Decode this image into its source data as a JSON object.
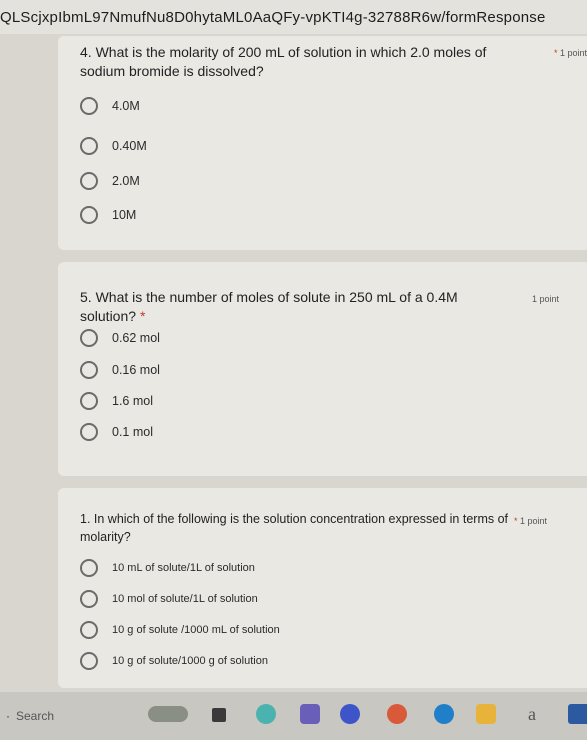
{
  "browser": {
    "url": "QLScjxpIbmL97NmufNu8D0hytaML0AaQFy-vpKTI4g-32788R6w/formResponse"
  },
  "questions": [
    {
      "title": "4. What is the molarity of 200 mL of solution in which 2.0 moles of sodium bromide is dissolved?",
      "required_mark": "*",
      "points": "1 point",
      "options": [
        "4.0M",
        "0.40M",
        "2.0M",
        "10M"
      ]
    },
    {
      "title": "5. What is the number of moles of solute in 250 mL of a 0.4M solution?",
      "required_mark": "*",
      "points": "1 point",
      "options": [
        "0.62 mol",
        "0.16 mol",
        "1.6 mol",
        "0.1 mol"
      ]
    },
    {
      "title": "1. In which of the following is the solution concentration expressed in terms of molarity?",
      "required_mark": "*",
      "points": "1 point",
      "options": [
        "10 mL of solute/1L of solution",
        "10 mol of solute/1L of solution",
        "10 g of solute /1000 mL of solution",
        "10 g of solute/1000 g of solution"
      ]
    }
  ],
  "taskbar": {
    "search_placeholder": "Search",
    "font_icon_glyph": "a",
    "icons": [
      "weather-icon",
      "task-view-icon",
      "widgets-icon",
      "teams-icon",
      "zoom-icon",
      "chrome-icon",
      "edge-icon",
      "file-explorer-icon",
      "font-icon",
      "store-icon"
    ]
  },
  "colors": {
    "page_background": "#d9d6cf",
    "card_background": "#eae8e3",
    "required": "#c0392b"
  }
}
